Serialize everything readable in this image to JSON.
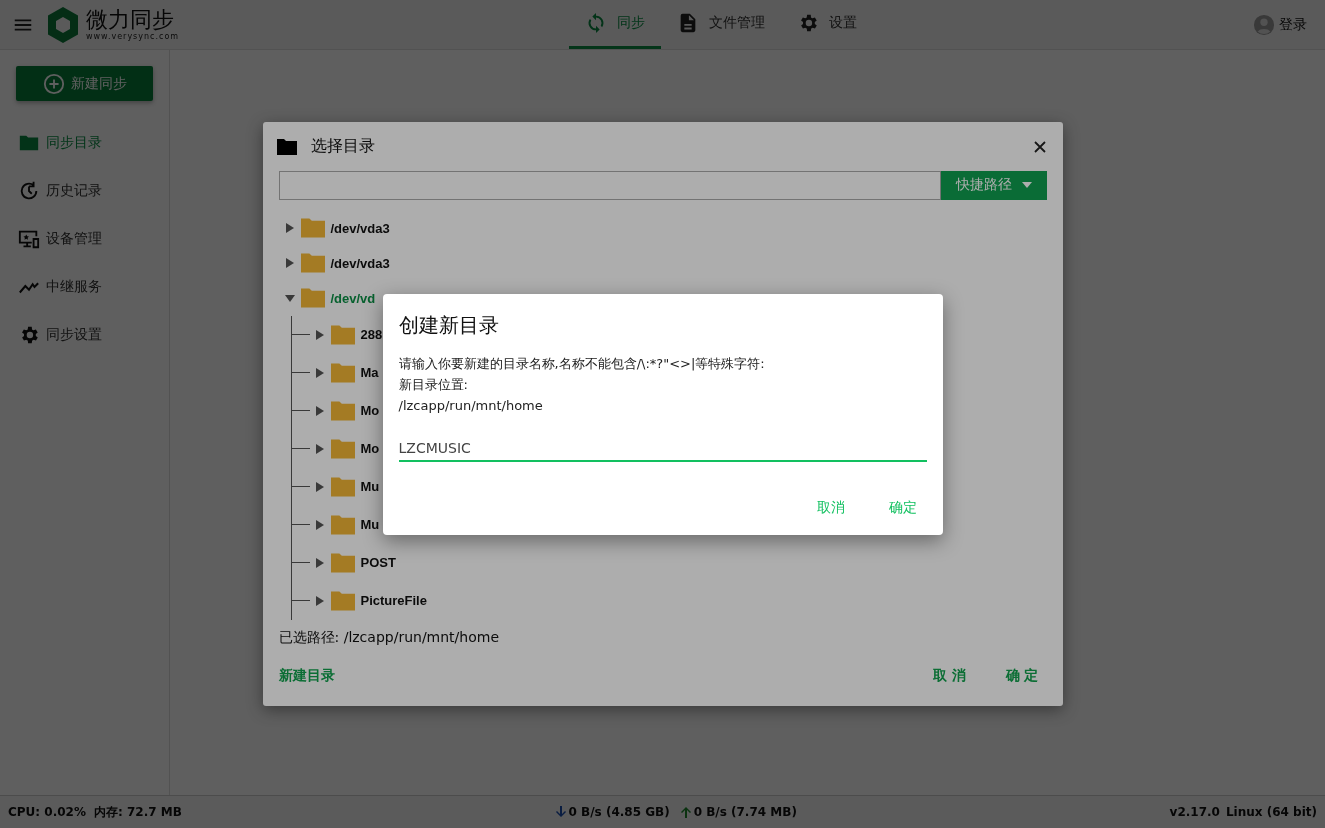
{
  "top_bar": {
    "app_name": "微力同步",
    "app_url": "www.verysync.com",
    "tabs": [
      {
        "label": "同步",
        "selected": true
      },
      {
        "label": "文件管理",
        "selected": false
      },
      {
        "label": "设置",
        "selected": false
      }
    ],
    "login": "登录"
  },
  "sidebar": {
    "new_button": "新建同步",
    "items": [
      {
        "label": "同步目录",
        "selected": true
      },
      {
        "label": "历史记录",
        "selected": false
      },
      {
        "label": "设备管理",
        "selected": false
      },
      {
        "label": "中继服务",
        "selected": false
      },
      {
        "label": "同步设置",
        "selected": false
      }
    ]
  },
  "select_dialog": {
    "title": "选择目录",
    "quick_path_button": "快捷路径",
    "tree": [
      {
        "label": "/dev/vda3",
        "expanded": false,
        "selected": false
      },
      {
        "label": "/dev/vda3",
        "expanded": false,
        "selected": false
      },
      {
        "label": "/dev/vd",
        "expanded": true,
        "selected": true,
        "children": [
          {
            "label": "288",
            "expanded": false,
            "selected": false
          },
          {
            "label": "Ma",
            "expanded": false,
            "selected": false
          },
          {
            "label": "Mo",
            "expanded": false,
            "selected": false
          },
          {
            "label": "Mo",
            "expanded": false,
            "selected": false
          },
          {
            "label": "Mu",
            "expanded": false,
            "selected": false
          },
          {
            "label": "Mu",
            "expanded": false,
            "selected": false
          },
          {
            "label": "POST",
            "expanded": false,
            "selected": false
          },
          {
            "label": "PictureFile",
            "expanded": false,
            "selected": false
          }
        ]
      }
    ],
    "selected_path": "已选路径: /lzcapp/run/mnt/home",
    "new_folder_button": "新建目录",
    "cancel_button": "取 消",
    "ok_button": "确 定"
  },
  "create_dialog": {
    "title": "创建新目录",
    "message": "请输入你要新建的目录名称,名称不能包含/\\:*?\"<>|等特殊字符:",
    "location_label": "新目录位置:",
    "location": "/lzcapp/run/mnt/home",
    "input": {
      "value": "LZCMUSIC"
    },
    "cancel_button": "取消",
    "ok_button": "确定"
  },
  "status_bar": {
    "cpu": "CPU: 0.02%",
    "memory": "内存: 72.7 MB",
    "download": "0 B/s (4.85 GB)",
    "upload": "0 B/s (7.74 MB)",
    "version": "v2.17.0",
    "os": "Linux (64 bit)"
  }
}
